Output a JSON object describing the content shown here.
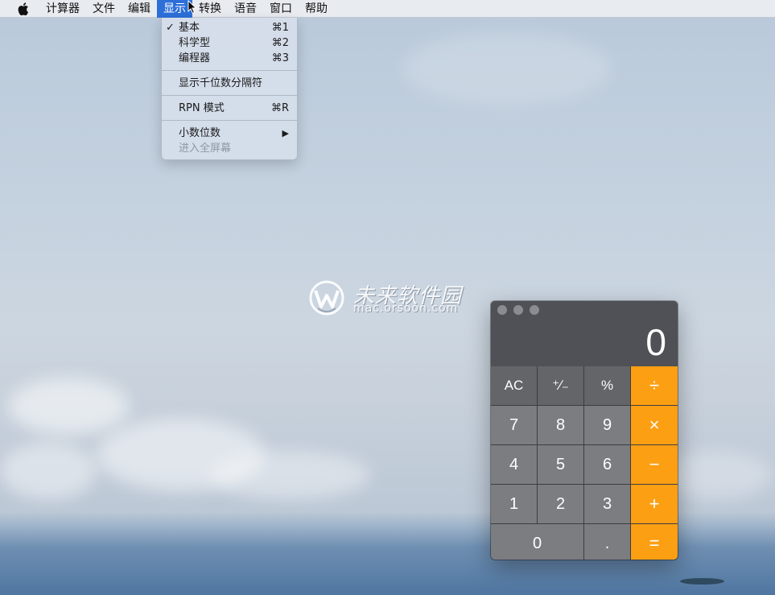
{
  "menubar": {
    "items": [
      "计算器",
      "文件",
      "编辑",
      "显示",
      "转换",
      "语音",
      "窗口",
      "帮助"
    ],
    "active_index": 3
  },
  "view_menu": {
    "group1": [
      {
        "label": "基本",
        "shortcut": "⌘1",
        "checked": true
      },
      {
        "label": "科学型",
        "shortcut": "⌘2",
        "checked": false
      },
      {
        "label": "编程器",
        "shortcut": "⌘3",
        "checked": false
      }
    ],
    "thousands_separator": "显示千位数分隔符",
    "rpn": {
      "label": "RPN 模式",
      "shortcut": "⌘R"
    },
    "decimal_places": {
      "label": "小数位数",
      "arrow": "▶"
    },
    "fullscreen": "进入全屏幕",
    "check_mark": "✓"
  },
  "watermark": {
    "title": "未来软件园",
    "url": "mac.orsoon.com"
  },
  "calculator": {
    "display": "0",
    "keys": {
      "ac": "AC",
      "sign": "⁺∕₋",
      "percent": "%",
      "divide": "÷",
      "seven": "7",
      "eight": "8",
      "nine": "9",
      "multiply": "×",
      "four": "4",
      "five": "5",
      "six": "6",
      "minus": "−",
      "one": "1",
      "two": "2",
      "three": "3",
      "plus": "+",
      "zero": "0",
      "decimal": ".",
      "equals": "="
    },
    "colors": {
      "operator": "#fd9f13",
      "function": "#646569",
      "digit": "#7c7d81",
      "display_bg": "#4f5157"
    }
  },
  "accent_color": "#2d6fd9"
}
